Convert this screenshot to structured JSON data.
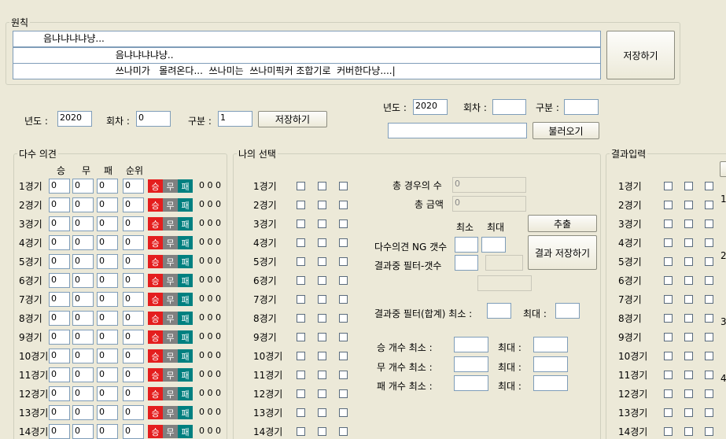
{
  "origin": {
    "title": "원칙",
    "lines": [
      "          음냐냐냐냐냥...",
      "                                  음냐냐냐냐냥..",
      "                                  쓰나미가   몰려온다...  쓰나미는  쓰나미픽커 조합기로  커버한다냥....|"
    ],
    "save_label": "저장하기"
  },
  "top_left": {
    "year_label": "년도 :",
    "year_value": "2020",
    "round_label": "회차 :",
    "round_value": "0",
    "type_label": "구분 :",
    "type_value": "1",
    "save_label": "저장하기"
  },
  "top_right": {
    "year_label": "년도 :",
    "year_value": "2020",
    "round_label": "회차 :",
    "round_value": "",
    "type_label": "구분 :",
    "type_value": "",
    "load_value": "",
    "load_label": "불러오기"
  },
  "majority": {
    "title": "다수 의견",
    "headers": [
      "승",
      "무",
      "패",
      "순위"
    ],
    "btn_win": "승",
    "btn_draw": "무",
    "btn_lose": "패",
    "rows": [
      {
        "label": "1경기",
        "v": [
          "0",
          "0",
          "0",
          "0"
        ],
        "triple": "0 0 0"
      },
      {
        "label": "2경기",
        "v": [
          "0",
          "0",
          "0",
          "0"
        ],
        "triple": "0 0 0"
      },
      {
        "label": "3경기",
        "v": [
          "0",
          "0",
          "0",
          "0"
        ],
        "triple": "0 0 0"
      },
      {
        "label": "4경기",
        "v": [
          "0",
          "0",
          "0",
          "0"
        ],
        "triple": "0 0 0"
      },
      {
        "label": "5경기",
        "v": [
          "0",
          "0",
          "0",
          "0"
        ],
        "triple": "0 0 0"
      },
      {
        "label": "6경기",
        "v": [
          "0",
          "0",
          "0",
          "0"
        ],
        "triple": "0 0 0"
      },
      {
        "label": "7경기",
        "v": [
          "0",
          "0",
          "0",
          "0"
        ],
        "triple": "0 0 0"
      },
      {
        "label": "8경기",
        "v": [
          "0",
          "0",
          "0",
          "0"
        ],
        "triple": "0 0 0"
      },
      {
        "label": "9경기",
        "v": [
          "0",
          "0",
          "0",
          "0"
        ],
        "triple": "0 0 0"
      },
      {
        "label": "10경기",
        "v": [
          "0",
          "0",
          "0",
          "0"
        ],
        "triple": "0 0 0"
      },
      {
        "label": "11경기",
        "v": [
          "0",
          "0",
          "0",
          "0"
        ],
        "triple": "0 0 0"
      },
      {
        "label": "12경기",
        "v": [
          "0",
          "0",
          "0",
          "0"
        ],
        "triple": "0 0 0"
      },
      {
        "label": "13경기",
        "v": [
          "0",
          "0",
          "0",
          "0"
        ],
        "triple": "0 0 0"
      },
      {
        "label": "14경기",
        "v": [
          "0",
          "0",
          "0",
          "0"
        ],
        "triple": "0 0 0"
      }
    ]
  },
  "my_choice": {
    "title": "나의 선택",
    "rows": [
      "1경기",
      "2경기",
      "3경기",
      "4경기",
      "5경기",
      "6경기",
      "7경기",
      "8경기",
      "9경기",
      "10경기",
      "11경기",
      "12경기",
      "13경기",
      "14경기"
    ],
    "total_cases_label": "총 경우의 수",
    "total_cases_value": "0",
    "total_amount_label": "총 금액",
    "total_amount_value": "0",
    "min_label": "최소",
    "max_label": "최대",
    "extract_label": "추출",
    "ng_label": "다수의견 NG 갯수",
    "filter_count_label": "결과중 필터-갯수",
    "save_result_label": "결과 저장하기",
    "filter_sum_label": "결과중 필터(합계)  최소 :",
    "filter_sum_max_label": "최대 :",
    "win_count_label": "승  개수   최소 :",
    "draw_count_label": "무  개수   최소 :",
    "lose_count_label": "패  개수   최소 :",
    "count_max_label": "최대 :"
  },
  "result_input": {
    "title": "결과입력",
    "rows": [
      "1경기",
      "2경기",
      "3경기",
      "4경기",
      "5경기",
      "6경기",
      "7경기",
      "8경기",
      "9경기",
      "10경기",
      "11경기",
      "12경기",
      "13경기",
      "14경기"
    ],
    "edge_labels": [
      "1",
      "2",
      "3",
      "4"
    ]
  },
  "colors": {
    "window_bg": "#ece9d8",
    "win": "#e41e1e",
    "draw": "#808080",
    "lose": "#008080"
  }
}
